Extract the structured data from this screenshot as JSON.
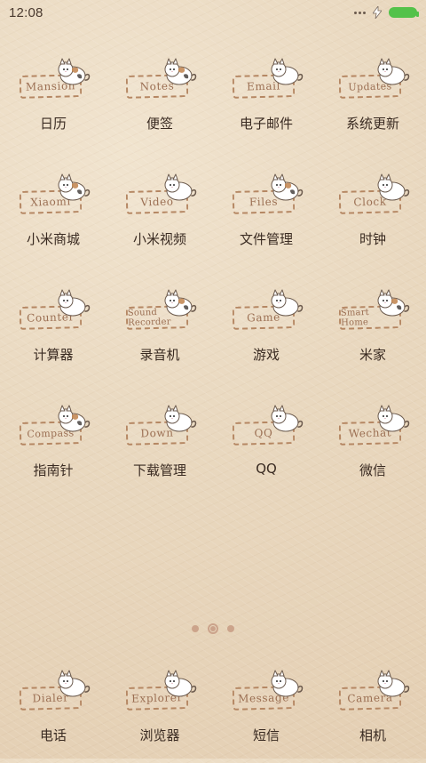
{
  "status_bar": {
    "time": "12:08",
    "icons": [
      "more-dots-icon",
      "charging-bolt-icon",
      "battery-icon"
    ],
    "battery_color": "#54c24a"
  },
  "home": {
    "apps": [
      {
        "label": "日历",
        "plate": "Mansion",
        "cat_style": "calico"
      },
      {
        "label": "便签",
        "plate": "Notes",
        "cat_style": "calico"
      },
      {
        "label": "电子邮件",
        "plate": "Email",
        "cat_style": "white"
      },
      {
        "label": "系统更新",
        "plate": "Updates",
        "cat_style": "white"
      },
      {
        "label": "小米商城",
        "plate": "Xiaomi",
        "cat_style": "calico"
      },
      {
        "label": "小米视频",
        "plate": "Video",
        "cat_style": "white"
      },
      {
        "label": "文件管理",
        "plate": "Files",
        "cat_style": "calico"
      },
      {
        "label": "时钟",
        "plate": "Clock",
        "cat_style": "white"
      },
      {
        "label": "计算器",
        "plate": "Counter",
        "cat_style": "white"
      },
      {
        "label": "录音机",
        "plate": "Sound Recorder",
        "cat_style": "calico"
      },
      {
        "label": "游戏",
        "plate": "Game",
        "cat_style": "white"
      },
      {
        "label": "米家",
        "plate": "Smart Home",
        "cat_style": "calico"
      },
      {
        "label": "指南针",
        "plate": "Compass",
        "cat_style": "calico"
      },
      {
        "label": "下载管理",
        "plate": "Down",
        "cat_style": "white"
      },
      {
        "label": "QQ",
        "plate": "QQ",
        "cat_style": "white"
      },
      {
        "label": "微信",
        "plate": "Wechat",
        "cat_style": "white"
      }
    ]
  },
  "page_indicator": {
    "count": 3,
    "active_index": 1
  },
  "dock": {
    "apps": [
      {
        "label": "电话",
        "plate": "Dialer",
        "cat_style": "white"
      },
      {
        "label": "浏览器",
        "plate": "Explorer",
        "cat_style": "white"
      },
      {
        "label": "短信",
        "plate": "Message",
        "cat_style": "white"
      },
      {
        "label": "相机",
        "plate": "Camera",
        "cat_style": "white"
      }
    ]
  },
  "colors": {
    "background_base": "#e9d8bf",
    "label_text": "#3a2b22",
    "plate_border": "#b58763",
    "page_dot": "#c79b83"
  }
}
